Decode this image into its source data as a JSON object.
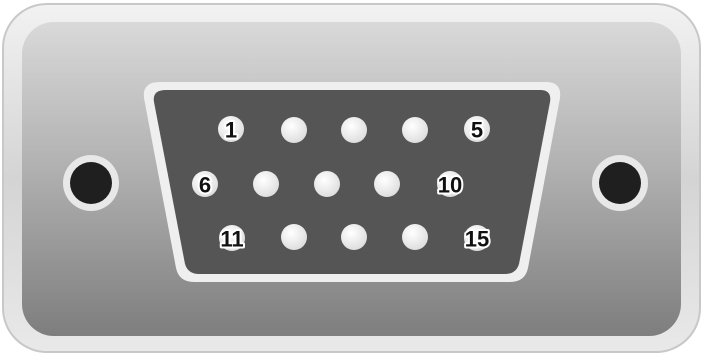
{
  "connector": {
    "shell_color": "#b9b9b9",
    "insert_color": "#555555",
    "pin_color": "#f4f4f4",
    "screw_color": "#1f1f1f",
    "pin_labels": {
      "p1": "1",
      "p5": "5",
      "p6": "6",
      "p10": "10",
      "p11": "11",
      "p15": "15"
    }
  }
}
